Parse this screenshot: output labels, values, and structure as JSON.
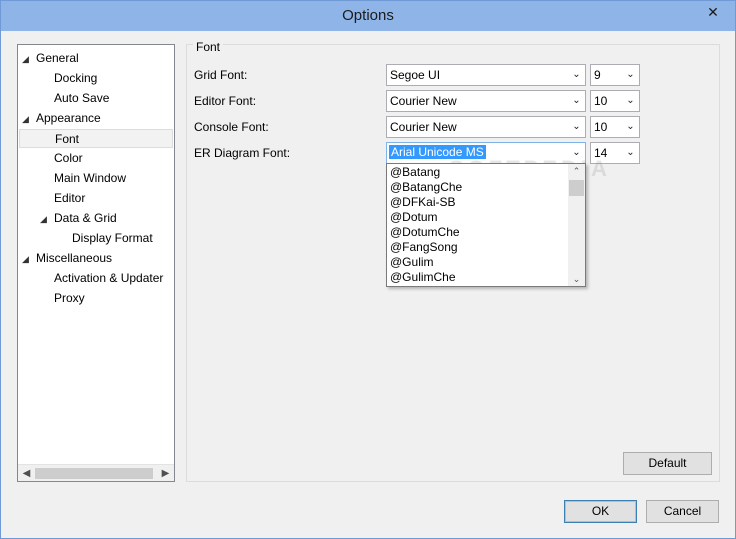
{
  "window": {
    "title": "Options",
    "close_glyph": "✕"
  },
  "tree": {
    "items": [
      {
        "label": "General",
        "level": 0,
        "expanded": true
      },
      {
        "label": "Docking",
        "level": 1
      },
      {
        "label": "Auto Save",
        "level": 1
      },
      {
        "label": "Appearance",
        "level": 0,
        "expanded": true
      },
      {
        "label": "Font",
        "level": 1,
        "selected": true
      },
      {
        "label": "Color",
        "level": 1
      },
      {
        "label": "Main Window",
        "level": 1
      },
      {
        "label": "Editor",
        "level": 1
      },
      {
        "label": "Data & Grid",
        "level": 1,
        "expanded": true
      },
      {
        "label": "Display Format",
        "level": 2
      },
      {
        "label": "Miscellaneous",
        "level": 0,
        "expanded": true
      },
      {
        "label": "Activation & Updater",
        "level": 1
      },
      {
        "label": "Proxy",
        "level": 1
      }
    ]
  },
  "panel": {
    "title": "Font",
    "rows": [
      {
        "label": "Grid Font:",
        "font": "Segoe UI",
        "size": "9"
      },
      {
        "label": "Editor Font:",
        "font": "Courier New",
        "size": "10"
      },
      {
        "label": "Console Font:",
        "font": "Courier New",
        "size": "10"
      },
      {
        "label": "ER Diagram Font:",
        "font": "Arial Unicode MS",
        "size": "14"
      }
    ],
    "dropdown_options": [
      "@Batang",
      "@BatangChe",
      "@DFKai-SB",
      "@Dotum",
      "@DotumChe",
      "@FangSong",
      "@Gulim",
      "@GulimChe"
    ]
  },
  "buttons": {
    "default": "Default",
    "ok": "OK",
    "cancel": "Cancel"
  },
  "watermark": "SOFTPEDIA"
}
